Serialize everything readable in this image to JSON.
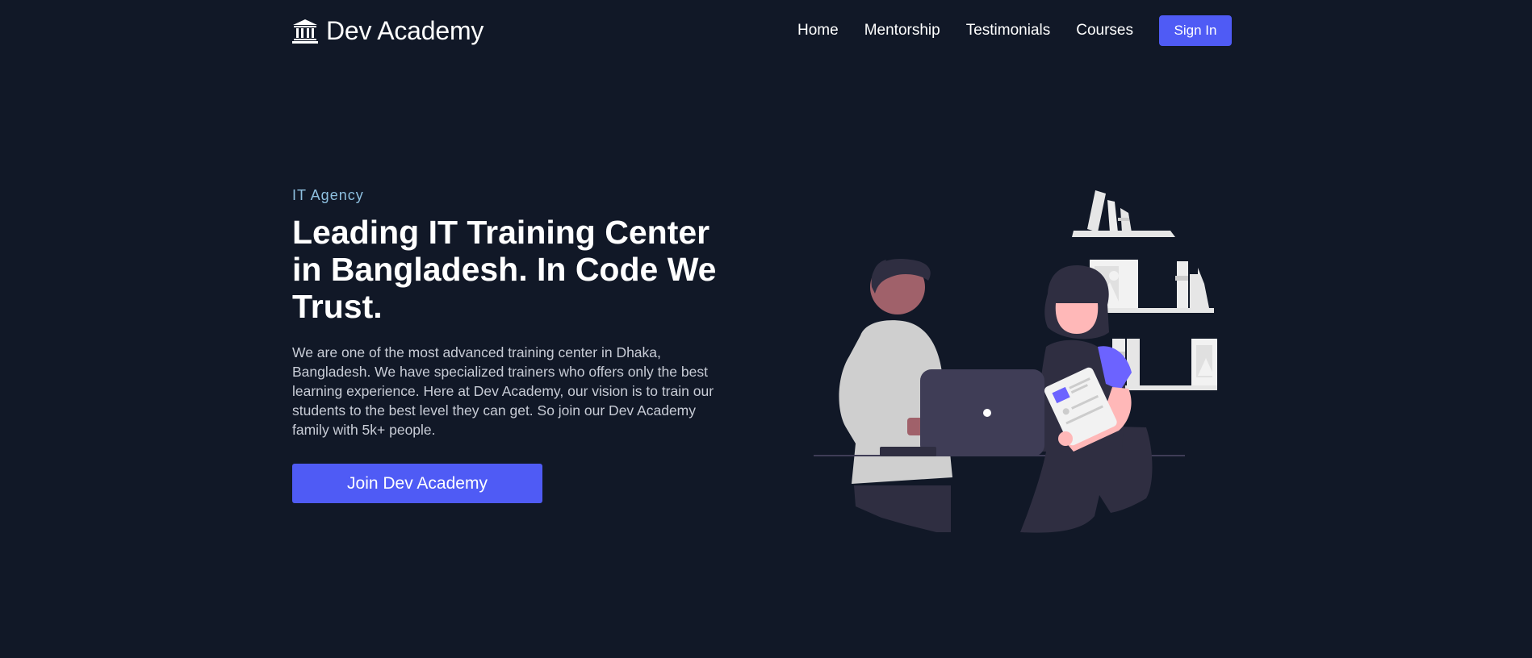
{
  "header": {
    "brand_name": "Dev Academy",
    "brand_icon": "institution-icon",
    "nav": [
      {
        "label": "Home"
      },
      {
        "label": "Mentorship"
      },
      {
        "label": "Testimonials"
      },
      {
        "label": "Courses"
      }
    ],
    "signin_label": "Sign In"
  },
  "hero": {
    "eyebrow": "IT Agency",
    "headline": "Leading IT Training Center in Bangladesh. In Code We Trust.",
    "description": "We are one of the most advanced training center in Dhaka, Bangladesh. We have specialized trainers who offers only the best learning experience. Here at Dev Academy, our vision is to train our students to the best level they can get. So join our Dev Academy family with 5k+ people.",
    "cta_label": "Join Dev Academy"
  },
  "colors": {
    "background": "#111827",
    "accent": "#4f5bf5",
    "eyebrow": "#8ec0e0"
  }
}
